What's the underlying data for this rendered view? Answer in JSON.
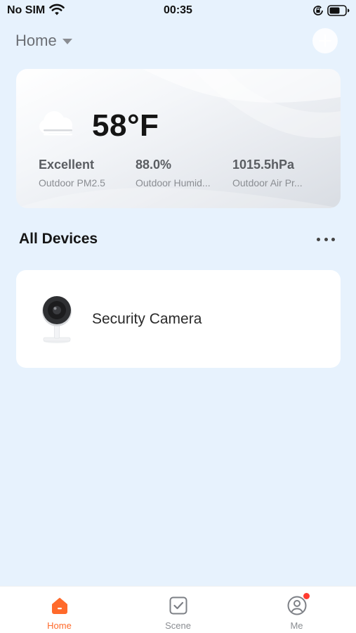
{
  "status_bar": {
    "carrier": "No SIM",
    "time": "00:35"
  },
  "header": {
    "home_label": "Home"
  },
  "weather": {
    "icon": "cloud-icon",
    "temperature": "58°F",
    "metrics": [
      {
        "value": "Excellent",
        "label": "Outdoor PM2.5"
      },
      {
        "value": "88.0%",
        "label": "Outdoor Humid..."
      },
      {
        "value": "1015.5hPa",
        "label": "Outdoor Air Pr..."
      }
    ]
  },
  "devices_section": {
    "title": "All Devices"
  },
  "devices": [
    {
      "name": "Security Camera",
      "icon": "security-camera-icon"
    }
  ],
  "tabs": [
    {
      "label": "Home",
      "icon": "home-icon",
      "active": true
    },
    {
      "label": "Scene",
      "icon": "scene-checkbox-icon",
      "active": false
    },
    {
      "label": "Me",
      "icon": "user-profile-icon",
      "active": false
    }
  ],
  "colors": {
    "accent": "#ff6a2b",
    "background": "#e7f2fd",
    "notification": "#ff3b30"
  }
}
